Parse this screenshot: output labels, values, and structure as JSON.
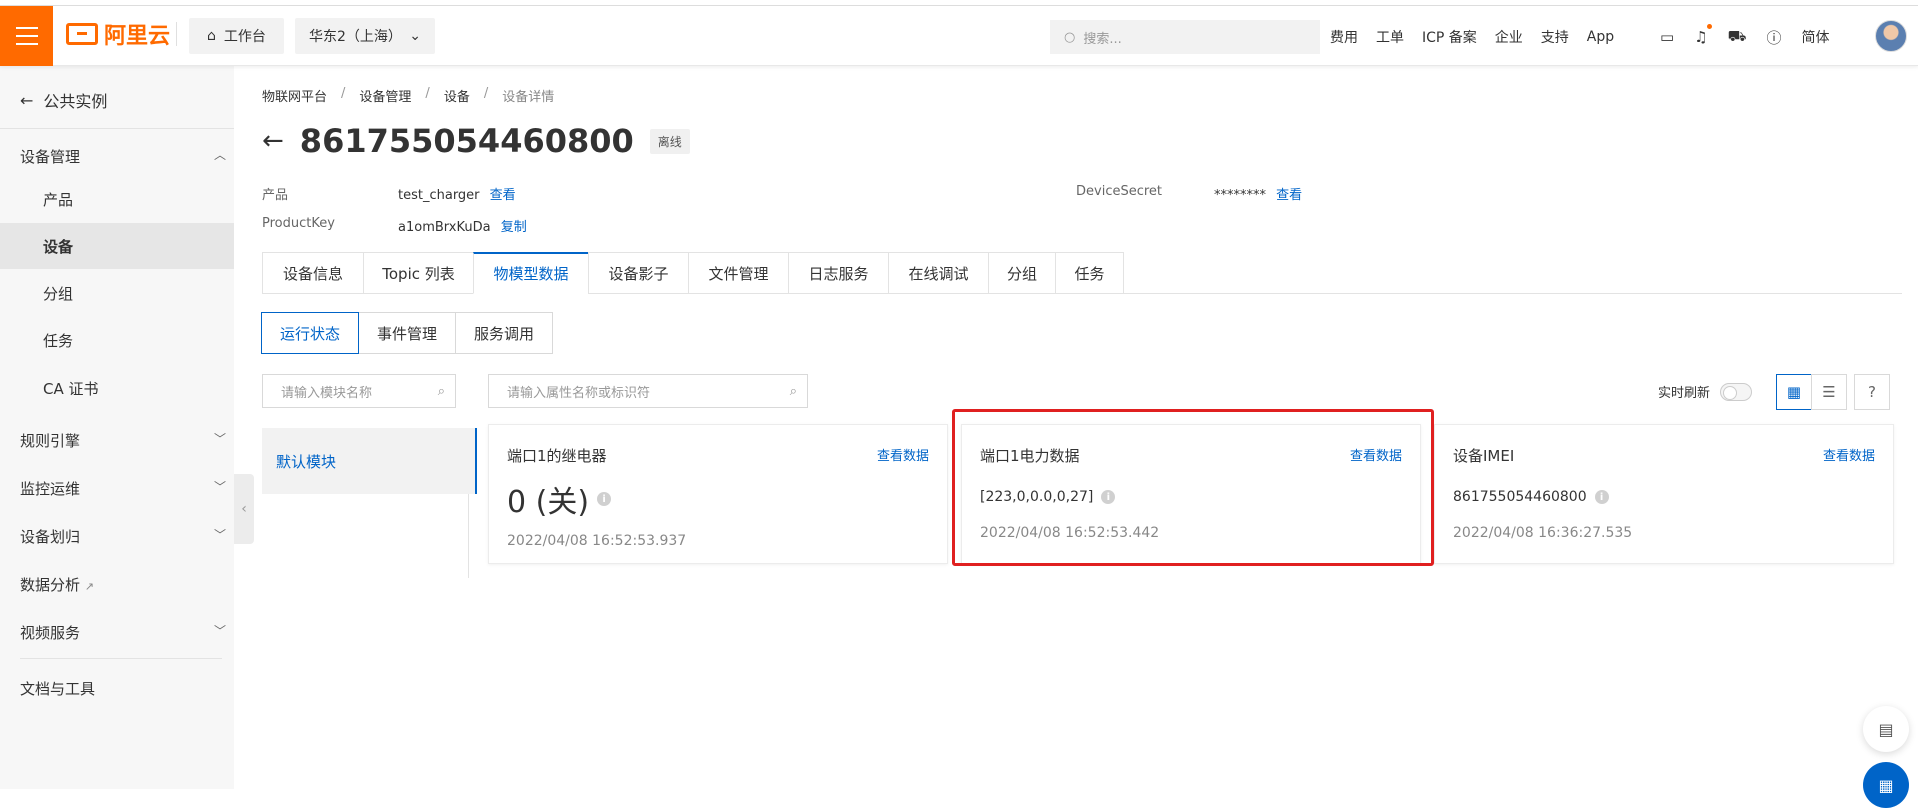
{
  "topbar": {
    "brand": "阿里云",
    "workbench": "工作台",
    "region": "华东2（上海）",
    "search_placeholder": "搜索...",
    "links": [
      "费用",
      "工单",
      "ICP 备案",
      "企业",
      "支持",
      "App"
    ],
    "lang": "简体"
  },
  "sidebar": {
    "back_label": "公共实例",
    "device_mgmt": "设备管理",
    "sub_items": [
      "产品",
      "设备",
      "分组",
      "任务",
      "CA 证书"
    ],
    "rule_engine": "规则引擎",
    "monitor": "监控运维",
    "device_assign": "设备划归",
    "data_analysis": "数据分析",
    "video_service": "视频服务",
    "docs_tools": "文档与工具"
  },
  "breadcrumb": [
    "物联网平台",
    "设备管理",
    "设备",
    "设备详情"
  ],
  "device": {
    "name": "861755054460800",
    "status": "离线",
    "product_label": "产品",
    "product_value": "test_charger",
    "product_link": "查看",
    "productkey_label": "ProductKey",
    "productkey_value": "a1omBrxKuDa",
    "productkey_link": "复制",
    "secret_label": "DeviceSecret",
    "secret_value": "********",
    "secret_link": "查看"
  },
  "tabs": [
    "设备信息",
    "Topic 列表",
    "物模型数据",
    "设备影子",
    "文件管理",
    "日志服务",
    "在线调试",
    "分组",
    "任务"
  ],
  "subtabs": [
    "运行状态",
    "事件管理",
    "服务调用"
  ],
  "module_search_placeholder": "请输入模块名称",
  "attr_search_placeholder": "请输入属性名称或标识符",
  "module_default": "默认模块",
  "realtime_label": "实时刷新",
  "cards": [
    {
      "name": "端口1的继电器",
      "link": "查看数据",
      "value": "0 (关)",
      "time": "2022/04/08 16:52:53.937"
    },
    {
      "name": "端口1电力数据",
      "link": "查看数据",
      "value": "[223,0,0.0,0,27]",
      "time": "2022/04/08 16:52:53.442"
    },
    {
      "name": "设备IMEI",
      "link": "查看数据",
      "value": "861755054460800",
      "time": "2022/04/08 16:36:27.535"
    }
  ]
}
